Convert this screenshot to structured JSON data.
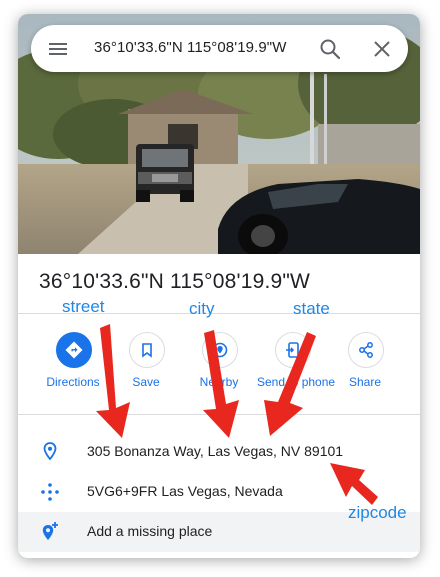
{
  "search": {
    "query": "36°10'33.6\"N 115°08'19.9\"W",
    "menu_icon": "hamburger-menu-icon",
    "search_icon": "search-icon",
    "close_icon": "close-icon"
  },
  "place": {
    "title": "36°10'33.6\"N 115°08'19.9\"W"
  },
  "actions": [
    {
      "label": "Directions",
      "icon": "directions-icon"
    },
    {
      "label": "Save",
      "icon": "bookmark-icon"
    },
    {
      "label": "Nearby",
      "icon": "nearby-icon"
    },
    {
      "label": "Send to phone",
      "icon": "send-to-phone-icon"
    },
    {
      "label": "Share",
      "icon": "share-icon"
    }
  ],
  "details": {
    "address": "305 Bonanza Way, Las Vegas, NV 89101",
    "plus_code": "5VG6+9FR Las Vegas, Nevada",
    "add_missing": "Add a missing place"
  },
  "annotations": {
    "street": "street",
    "city": "city",
    "state": "state",
    "zipcode": "zipcode"
  },
  "colors": {
    "accent": "#1a73e8",
    "annotation_text": "#1e88e5",
    "arrow": "#e8281e"
  }
}
